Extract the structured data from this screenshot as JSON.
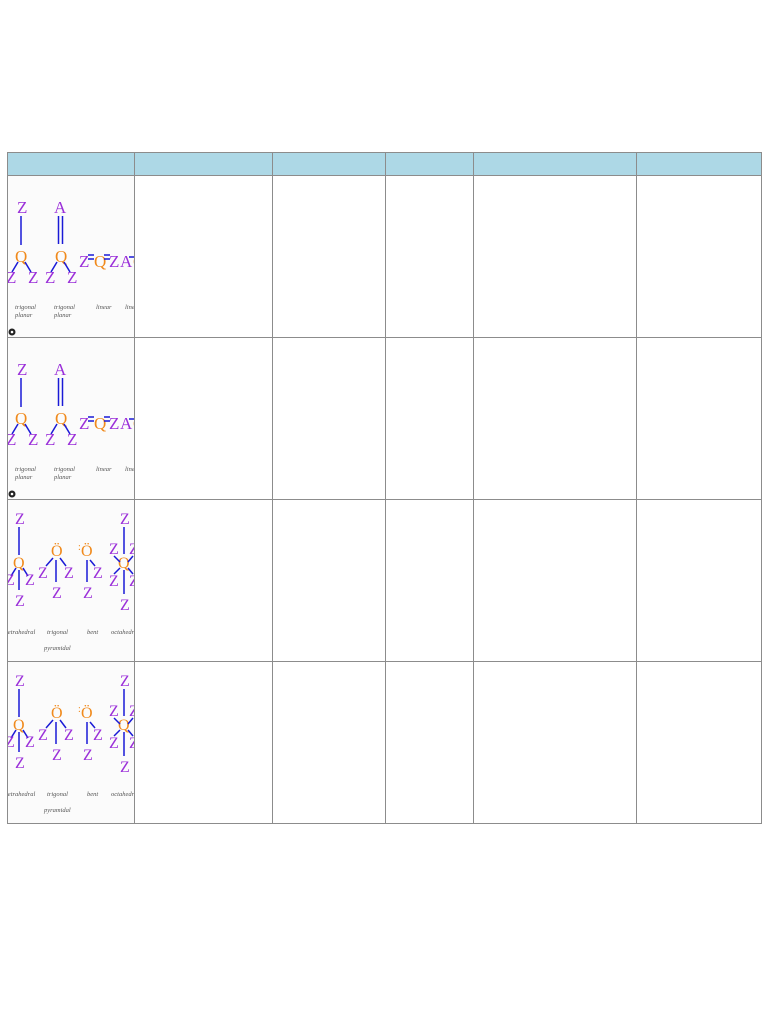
{
  "table": {
    "header": [
      "",
      "",
      "",
      "",
      "",
      ""
    ],
    "rows": [
      {
        "figure": {
          "atom_symbols": [
            "Z",
            "A",
            "Q"
          ],
          "labels": [
            [
              "trigonal",
              "planar"
            ],
            [
              "trigonal",
              "planar"
            ],
            [
              "linear"
            ],
            [
              "linear"
            ]
          ]
        },
        "cells": [
          "",
          "",
          "",
          "",
          ""
        ]
      },
      {
        "figure": {
          "atom_symbols": [
            "Z",
            "A",
            "Q"
          ],
          "labels": [
            [
              "trigonal",
              "planar"
            ],
            [
              "trigonal",
              "planar"
            ],
            [
              "linear"
            ],
            [
              "linear"
            ]
          ]
        },
        "cells": [
          "",
          "",
          "",
          "",
          ""
        ]
      },
      {
        "figure": {
          "atom_symbols": [
            "Z",
            "Q",
            "Ö"
          ],
          "labels": [
            [
              "tetrahedral"
            ],
            [
              "trigonal",
              "pyramidal"
            ],
            [
              "bent"
            ],
            [
              "octahedral"
            ]
          ]
        },
        "cells": [
          "",
          "",
          "",
          "",
          ""
        ]
      },
      {
        "figure": {
          "atom_symbols": [
            "Z",
            "Q",
            "Ö"
          ],
          "labels": [
            [
              "tetrahedral"
            ],
            [
              "trigonal",
              "pyramidal"
            ],
            [
              "bent"
            ],
            [
              "octahedral"
            ]
          ]
        },
        "cells": [
          "",
          "",
          "",
          "",
          ""
        ]
      }
    ]
  },
  "colors": {
    "header_bg": "#add8e6",
    "border": "#8c8c8c",
    "atom_outer": "#9b30d9",
    "atom_center": "#f08a1c",
    "bond": "#1a1ad6",
    "label": "#555555"
  },
  "icons": {
    "marker": "record-dot-icon"
  }
}
